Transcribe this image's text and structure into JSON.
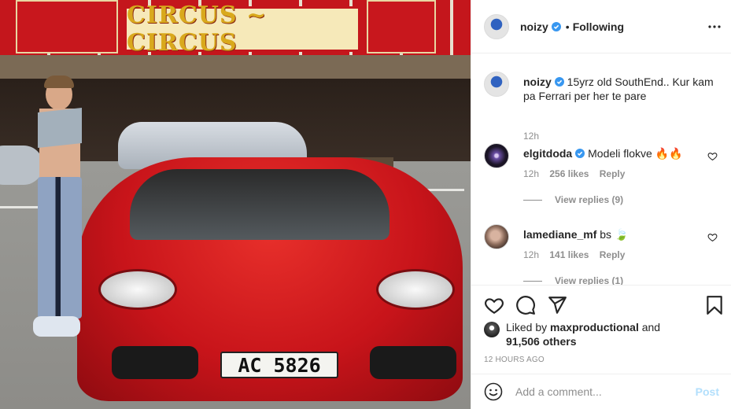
{
  "post": {
    "author": "noizy",
    "follow_status": "Following",
    "separator": "•",
    "caption": "15yrz old SouthEnd.. Kur kam pa Ferrari per her te pare",
    "caption_time": "12h",
    "image": {
      "sign_text": "CIRCUS ~ CIRCUS",
      "plate_text": "AC 5826"
    }
  },
  "comments": [
    {
      "username": "elgitdoda",
      "verified": true,
      "text": "Modeli flokve 🔥🔥",
      "time": "12h",
      "likes": "256 likes",
      "reply_label": "Reply",
      "view_replies": "View replies (9)"
    },
    {
      "username": "lamediane_mf",
      "verified": false,
      "text": "bs 🍃",
      "time": "12h",
      "likes": "141 likes",
      "reply_label": "Reply",
      "view_replies": "View replies (1)"
    }
  ],
  "engagement": {
    "liked_by_prefix": "Liked by",
    "liked_by_user": "maxproductional",
    "and_label": "and",
    "others": "91,506 others",
    "timestamp": "12 HOURS AGO"
  },
  "composer": {
    "placeholder": "Add a comment...",
    "post_label": "Post"
  },
  "icons": {
    "like": "heart-icon",
    "comment": "comment-icon",
    "share": "share-icon",
    "save": "bookmark-icon",
    "more": "more-options-icon",
    "emoji": "emoji-icon",
    "verified": "verified-badge-icon"
  },
  "colors": {
    "verified": "#3897f0",
    "post_button_disabled": "#b2dffc",
    "meta_text": "#8e8e8e"
  }
}
